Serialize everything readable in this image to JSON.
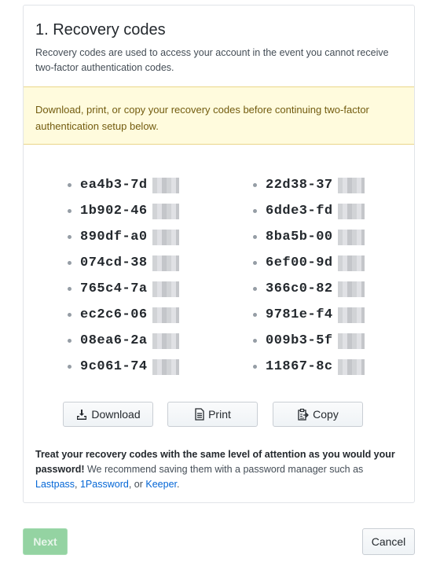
{
  "section": {
    "title": "1. Recovery codes",
    "description": "Recovery codes are used to access your account in the event you cannot receive two-factor authentication codes."
  },
  "warning": {
    "text": "Download, print, or copy your recovery codes before continuing two-factor authentication setup below."
  },
  "codes": {
    "left": [
      "ea4b3-7d",
      "1b902-46",
      "890df-a0",
      "074cd-38",
      "765c4-7a",
      "ec2c6-06",
      "08ea6-2a",
      "9c061-74"
    ],
    "right": [
      "22d38-37",
      "6dde3-fd",
      "8ba5b-00",
      "6ef00-9d",
      "366c0-82",
      "9781e-f4",
      "009b3-5f",
      "11867-8c"
    ]
  },
  "actions": {
    "download": "Download",
    "print": "Print",
    "copy": "Copy"
  },
  "note": {
    "bold": "Treat your recovery codes with the same level of attention as you would your password!",
    "text": " We recommend saving them with a password manager such as ",
    "link1": "Lastpass",
    "sep1": ", ",
    "link2": "1Password",
    "sep2": ", or ",
    "link3": "Keeper",
    "end": "."
  },
  "footer": {
    "next": "Next",
    "cancel": "Cancel"
  },
  "icons": {
    "download": "download-icon",
    "print": "file-icon",
    "copy": "clippy-icon"
  }
}
